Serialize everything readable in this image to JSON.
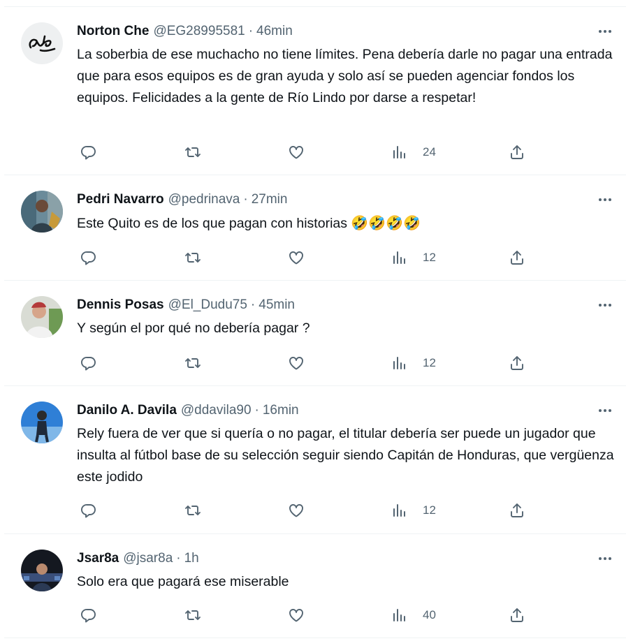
{
  "tweets": [
    {
      "name": "Norton Che",
      "handle": "@EG28995581",
      "dot": "·",
      "time": "46min",
      "avatar": "signature-logo",
      "text": "La soberbia de ese muchacho no tiene límites. Pena debería darle no pagar una entrada que para esos equipos es de gran ayuda y solo así se pueden agenciar fondos los equipos. Felicidades a la gente de Río Lindo por darse a respetar!",
      "views": "24"
    },
    {
      "name": "Pedri Navarro",
      "handle": "@pedrinava",
      "dot": "·",
      "time": "27min",
      "avatar": "person-photo",
      "text": "Este Quito es de los que pagan con historias ",
      "emoji": "🤣🤣🤣🤣",
      "views": "12"
    },
    {
      "name": "Dennis Posas",
      "handle": "@El_Dudu75",
      "dot": "·",
      "time": "45min",
      "avatar": "person-photo",
      "text": "Y según el por qué no debería pagar ?",
      "views": "12"
    },
    {
      "name": "Danilo A. Davila",
      "handle": "@ddavila90",
      "dot": "·",
      "time": "16min",
      "avatar": "person-photo",
      "text": "Rely fuera de ver que si quería o no pagar, el titular debería ser puede un jugador que insulta al fútbol base de su selección seguir siendo Capitán de Honduras, que vergüenza este jodido",
      "views": "12"
    },
    {
      "name": "Jsar8a",
      "handle": "@jsar8a",
      "dot": "·",
      "time": "1h",
      "avatar": "person-photo",
      "text": "Solo era que pagará ese miserable",
      "views": "40"
    }
  ],
  "icons": {
    "reply": "reply-icon",
    "retweet": "retweet-icon",
    "like": "like-icon",
    "views": "views-icon",
    "share": "share-icon",
    "more": "more-icon"
  },
  "colors": {
    "text": "#0f1419",
    "secondary": "#536471",
    "divider": "#eff3f4"
  }
}
